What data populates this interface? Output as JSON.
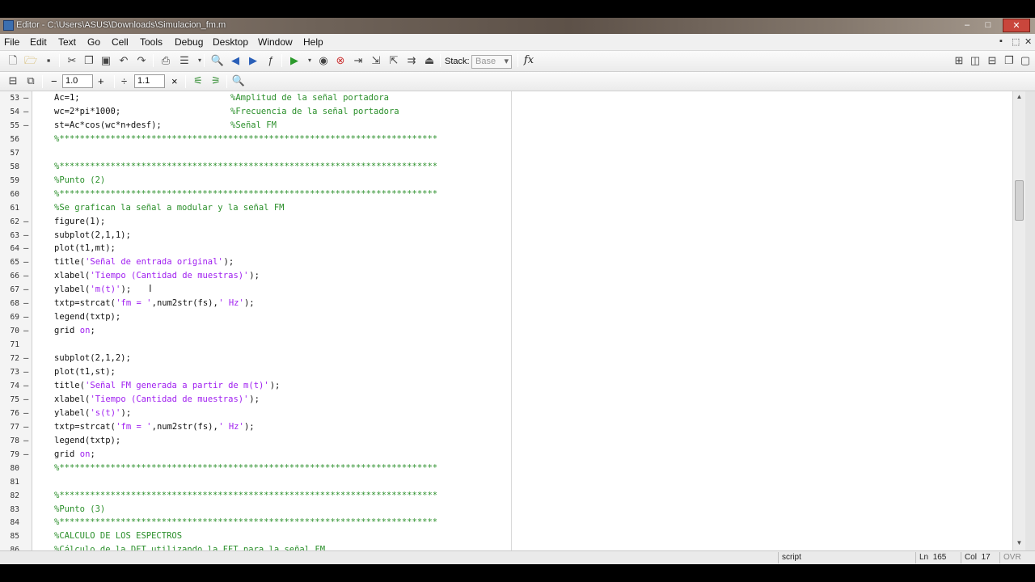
{
  "window": {
    "title": "Editor - C:\\Users\\ASUS\\Downloads\\Simulacion_fm.m",
    "minimize": "–",
    "maximize": "□",
    "close": "✕"
  },
  "menu": [
    "File",
    "Edit",
    "Text",
    "Go",
    "Cell",
    "Tools",
    "Debug",
    "Desktop",
    "Window",
    "Help"
  ],
  "toolbar": {
    "stack_label": "Stack:",
    "stack_value": "Base",
    "fx_label": "fx"
  },
  "cell_toolbar": {
    "decrement": "−",
    "value1": "1.0",
    "increment": "+",
    "divide_label": "÷",
    "value2": "1.1",
    "multiply": "×"
  },
  "code": [
    {
      "n": "53",
      "m": "–",
      "parts": [
        {
          "t": "Ac=1;",
          "c": "text"
        },
        {
          "t": "%Amplitud de la señal portadora",
          "c": "comment",
          "col": 218
        }
      ]
    },
    {
      "n": "54",
      "m": "–",
      "parts": [
        {
          "t": "wc=2*pi*1000;",
          "c": "text"
        },
        {
          "t": "%Frecuencia de la señal portadora",
          "c": "comment",
          "col": 218
        }
      ]
    },
    {
      "n": "55",
      "m": "–",
      "parts": [
        {
          "t": "st=Ac*cos(wc*n+desf);",
          "c": "text"
        },
        {
          "t": "%Señal FM",
          "c": "comment",
          "col": 218
        }
      ]
    },
    {
      "n": "56",
      "m": "",
      "parts": [
        {
          "t": "%**************************************************************************",
          "c": "comment"
        }
      ]
    },
    {
      "n": "57",
      "m": "",
      "parts": []
    },
    {
      "n": "58",
      "m": "",
      "parts": [
        {
          "t": "%**************************************************************************",
          "c": "comment"
        }
      ]
    },
    {
      "n": "59",
      "m": "",
      "parts": [
        {
          "t": "%Punto (2)",
          "c": "comment"
        }
      ]
    },
    {
      "n": "60",
      "m": "",
      "parts": [
        {
          "t": "%**************************************************************************",
          "c": "comment"
        }
      ]
    },
    {
      "n": "61",
      "m": "",
      "parts": [
        {
          "t": "%Se grafican la señal a modular y la señal FM",
          "c": "comment"
        }
      ]
    },
    {
      "n": "62",
      "m": "–",
      "parts": [
        {
          "t": "figure(1);",
          "c": "text"
        }
      ]
    },
    {
      "n": "63",
      "m": "–",
      "parts": [
        {
          "t": "subplot(2,1,1);",
          "c": "text"
        }
      ]
    },
    {
      "n": "64",
      "m": "–",
      "parts": [
        {
          "t": "plot(t1,mt);",
          "c": "text"
        }
      ]
    },
    {
      "n": "65",
      "m": "–",
      "parts": [
        {
          "t": "title(",
          "c": "text"
        },
        {
          "t": "'Señal de entrada original'",
          "c": "string"
        },
        {
          "t": ");",
          "c": "text"
        }
      ]
    },
    {
      "n": "66",
      "m": "–",
      "parts": [
        {
          "t": "xlabel(",
          "c": "text"
        },
        {
          "t": "'Tiempo (Cantidad de muestras)'",
          "c": "string"
        },
        {
          "t": ");",
          "c": "text"
        }
      ]
    },
    {
      "n": "67",
      "m": "–",
      "parts": [
        {
          "t": "ylabel(",
          "c": "text"
        },
        {
          "t": "'m(t)'",
          "c": "string"
        },
        {
          "t": ");",
          "c": "text"
        }
      ]
    },
    {
      "n": "68",
      "m": "–",
      "parts": [
        {
          "t": "txtp=strcat(",
          "c": "text"
        },
        {
          "t": "'fm = '",
          "c": "string"
        },
        {
          "t": ",num2str(fs),",
          "c": "text"
        },
        {
          "t": "' Hz'",
          "c": "string"
        },
        {
          "t": ");",
          "c": "text"
        }
      ]
    },
    {
      "n": "69",
      "m": "–",
      "parts": [
        {
          "t": "legend(txtp);",
          "c": "text"
        }
      ]
    },
    {
      "n": "70",
      "m": "–",
      "parts": [
        {
          "t": "grid ",
          "c": "text"
        },
        {
          "t": "on",
          "c": "string"
        },
        {
          "t": ";",
          "c": "text"
        }
      ]
    },
    {
      "n": "71",
      "m": "",
      "parts": []
    },
    {
      "n": "72",
      "m": "–",
      "parts": [
        {
          "t": "subplot(2,1,2);",
          "c": "text"
        }
      ]
    },
    {
      "n": "73",
      "m": "–",
      "parts": [
        {
          "t": "plot(t1,st);",
          "c": "text"
        }
      ]
    },
    {
      "n": "74",
      "m": "–",
      "parts": [
        {
          "t": "title(",
          "c": "text"
        },
        {
          "t": "'Señal FM generada a partir de m(t)'",
          "c": "string"
        },
        {
          "t": ");",
          "c": "text"
        }
      ]
    },
    {
      "n": "75",
      "m": "–",
      "parts": [
        {
          "t": "xlabel(",
          "c": "text"
        },
        {
          "t": "'Tiempo (Cantidad de muestras)'",
          "c": "string"
        },
        {
          "t": ");",
          "c": "text"
        }
      ]
    },
    {
      "n": "76",
      "m": "–",
      "parts": [
        {
          "t": "ylabel(",
          "c": "text"
        },
        {
          "t": "'s(t)'",
          "c": "string"
        },
        {
          "t": ");",
          "c": "text"
        }
      ]
    },
    {
      "n": "77",
      "m": "–",
      "parts": [
        {
          "t": "txtp=strcat(",
          "c": "text"
        },
        {
          "t": "'fm = '",
          "c": "string"
        },
        {
          "t": ",num2str(fs),",
          "c": "text"
        },
        {
          "t": "' Hz'",
          "c": "string"
        },
        {
          "t": ");",
          "c": "text"
        }
      ]
    },
    {
      "n": "78",
      "m": "–",
      "parts": [
        {
          "t": "legend(txtp);",
          "c": "text"
        }
      ]
    },
    {
      "n": "79",
      "m": "–",
      "parts": [
        {
          "t": "grid ",
          "c": "text"
        },
        {
          "t": "on",
          "c": "string"
        },
        {
          "t": ";",
          "c": "text"
        }
      ]
    },
    {
      "n": "80",
      "m": "",
      "parts": [
        {
          "t": "%**************************************************************************",
          "c": "comment"
        }
      ]
    },
    {
      "n": "81",
      "m": "",
      "parts": []
    },
    {
      "n": "82",
      "m": "",
      "parts": [
        {
          "t": "%**************************************************************************",
          "c": "comment"
        }
      ]
    },
    {
      "n": "83",
      "m": "",
      "parts": [
        {
          "t": "%Punto (3)",
          "c": "comment"
        }
      ]
    },
    {
      "n": "84",
      "m": "",
      "parts": [
        {
          "t": "%**************************************************************************",
          "c": "comment"
        }
      ]
    },
    {
      "n": "85",
      "m": "",
      "parts": [
        {
          "t": "%CALCULO DE LOS ESPECTROS",
          "c": "comment"
        }
      ]
    },
    {
      "n": "86",
      "m": "",
      "parts": [
        {
          "t": "%Cálculo de la DFT utilizando la FFT para la señal FM",
          "c": "comment"
        }
      ]
    }
  ],
  "status": {
    "mode": "script",
    "ln_label": "Ln",
    "ln_value": "165",
    "col_label": "Col",
    "col_value": "17",
    "ovr": "OVR"
  },
  "colors": {
    "comment": "#2a8f2a",
    "string": "#a020f0",
    "keyword": "#0000ff"
  }
}
